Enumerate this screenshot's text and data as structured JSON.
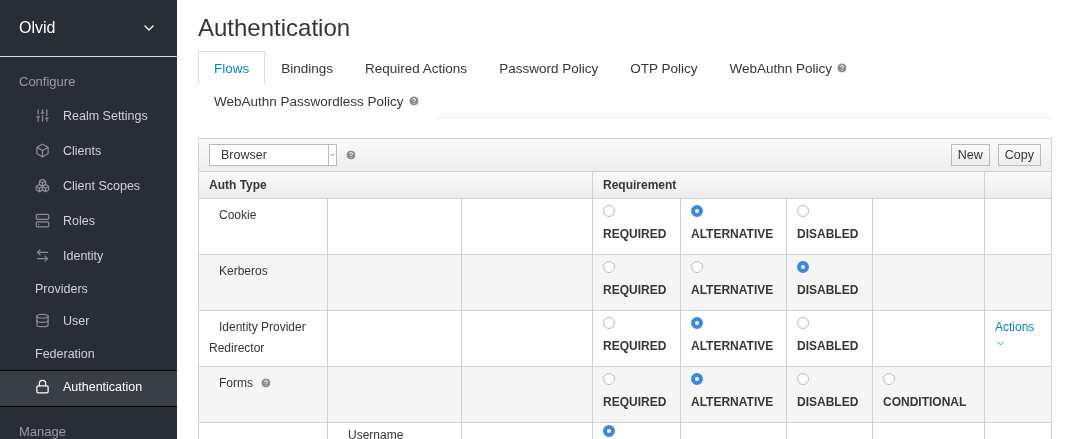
{
  "sidebar": {
    "realm": "Olvid",
    "sections": [
      {
        "title": "Configure",
        "items": [
          {
            "label": "Realm Settings",
            "selected": false
          },
          {
            "label": "Clients",
            "selected": false
          },
          {
            "label": "Client Scopes",
            "selected": false
          },
          {
            "label": "Roles",
            "selected": false
          },
          {
            "label": "Identity Providers",
            "selected": false
          },
          {
            "label": "User Federation",
            "selected": false
          },
          {
            "label": "Authentication",
            "selected": true
          }
        ]
      },
      {
        "title": "Manage"
      }
    ]
  },
  "page": {
    "title": "Authentication"
  },
  "tabs": [
    {
      "label": "Flows",
      "selected": true,
      "help": false
    },
    {
      "label": "Bindings",
      "selected": false,
      "help": false
    },
    {
      "label": "Required Actions",
      "selected": false,
      "help": false
    },
    {
      "label": "Password Policy",
      "selected": false,
      "help": false
    },
    {
      "label": "OTP Policy",
      "selected": false,
      "help": false
    },
    {
      "label": "WebAuthn Policy",
      "selected": false,
      "help": true
    },
    {
      "label": "WebAuthn Passwordless Policy",
      "selected": false,
      "help": true
    }
  ],
  "toolbar": {
    "flow_select": "Browser",
    "buttons": [
      "New",
      "Copy"
    ]
  },
  "table": {
    "columns": [
      "Auth Type",
      "Requirement"
    ],
    "rows": [
      {
        "auth_type": "Cookie",
        "help": false,
        "choices": [
          {
            "label": "REQUIRED",
            "selected": false
          },
          {
            "label": "ALTERNATIVE",
            "selected": true
          },
          {
            "label": "DISABLED",
            "selected": false
          }
        ]
      },
      {
        "auth_type": "Kerberos",
        "help": false,
        "choices": [
          {
            "label": "REQUIRED",
            "selected": false
          },
          {
            "label": "ALTERNATIVE",
            "selected": false
          },
          {
            "label": "DISABLED",
            "selected": true
          }
        ]
      },
      {
        "auth_type": "Identity Provider Redirector",
        "help": false,
        "action": "Actions",
        "choices": [
          {
            "label": "REQUIRED",
            "selected": false
          },
          {
            "label": "ALTERNATIVE",
            "selected": true
          },
          {
            "label": "DISABLED",
            "selected": false
          }
        ]
      },
      {
        "auth_type": "Forms",
        "help": true,
        "choices": [
          {
            "label": "REQUIRED",
            "selected": false
          },
          {
            "label": "ALTERNATIVE",
            "selected": true
          },
          {
            "label": "DISABLED",
            "selected": false
          },
          {
            "label": "CONDITIONAL",
            "selected": false
          }
        ],
        "children": [
          {
            "auth_type": "Username",
            "choices": [
              {
                "selected": true
              }
            ]
          }
        ]
      }
    ]
  }
}
